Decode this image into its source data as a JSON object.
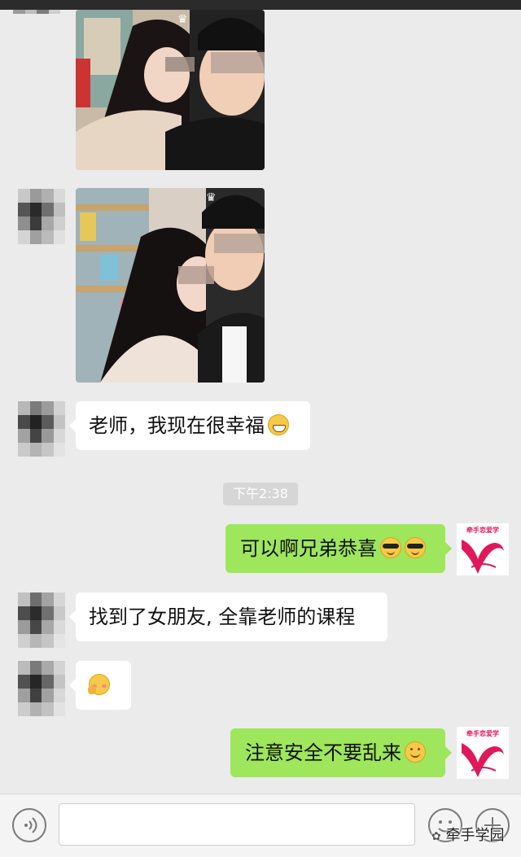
{
  "timestamp": "下午2:38",
  "messages": [
    {
      "side": "left",
      "type": "image"
    },
    {
      "side": "left",
      "type": "image"
    },
    {
      "side": "left",
      "type": "text",
      "text": "老师，我现在很幸福",
      "emoji": "grin"
    },
    {
      "side": "right",
      "type": "text",
      "text": "可以啊兄弟恭喜",
      "emoji": "cool-cool"
    },
    {
      "side": "left",
      "type": "text",
      "text": "找到了女朋友, 全靠老师的课程",
      "emoji": ""
    },
    {
      "side": "left",
      "type": "emoji",
      "emoji": "shy"
    },
    {
      "side": "right",
      "type": "text",
      "text": "注意安全不要乱来",
      "emoji": "smile"
    }
  ],
  "teacher_avatar": {
    "logo_text": "牵手恋爱学"
  },
  "input_bar": {
    "voice_icon": "voice-icon",
    "emoji_icon": "emoji-face-icon",
    "plus_icon": "plus-icon"
  },
  "watermark": {
    "text": "牵手学园"
  },
  "colors": {
    "background": "#ebebeb",
    "bubble_self": "#9ee65c",
    "bubble_other": "#ffffff",
    "brand": "#e0185a"
  }
}
